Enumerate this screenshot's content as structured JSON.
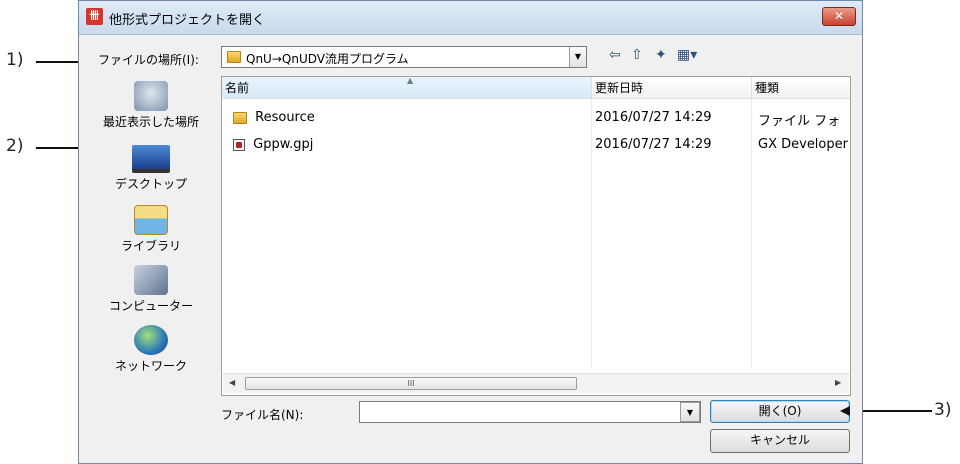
{
  "dialog": {
    "title": "他形式プロジェクトを開く",
    "app_icon_text": "卌",
    "close_symbol": "✕"
  },
  "lookin": {
    "label": "ファイルの場所(I):",
    "value": "QnU→QnUDV流用プログラム"
  },
  "places": [
    {
      "label": "最近表示した場所",
      "icon": "recent-places-icon"
    },
    {
      "label": "デスクトップ",
      "icon": "desktop-icon"
    },
    {
      "label": "ライブラリ",
      "icon": "library-icon"
    },
    {
      "label": "コンピューター",
      "icon": "computer-icon"
    },
    {
      "label": "ネットワーク",
      "icon": "network-icon"
    }
  ],
  "columns": {
    "name": "名前",
    "modified": "更新日時",
    "type": "種類"
  },
  "files": [
    {
      "name": "Resource",
      "modified": "2016/07/27 14:29",
      "type": "ファイル フォ",
      "icon": "folder-icon"
    },
    {
      "name": "Gppw.gpj",
      "modified": "2016/07/27 14:29",
      "type": "GX Developer",
      "icon": "gpj-file-icon"
    }
  ],
  "filename": {
    "label": "ファイル名(N):",
    "value": ""
  },
  "buttons": {
    "open": "開く(O)",
    "cancel": "キャンセル"
  },
  "callouts": {
    "c1": "1)",
    "c2": "2)",
    "c3": "3)"
  },
  "scrollbar": {
    "grip": "III"
  }
}
